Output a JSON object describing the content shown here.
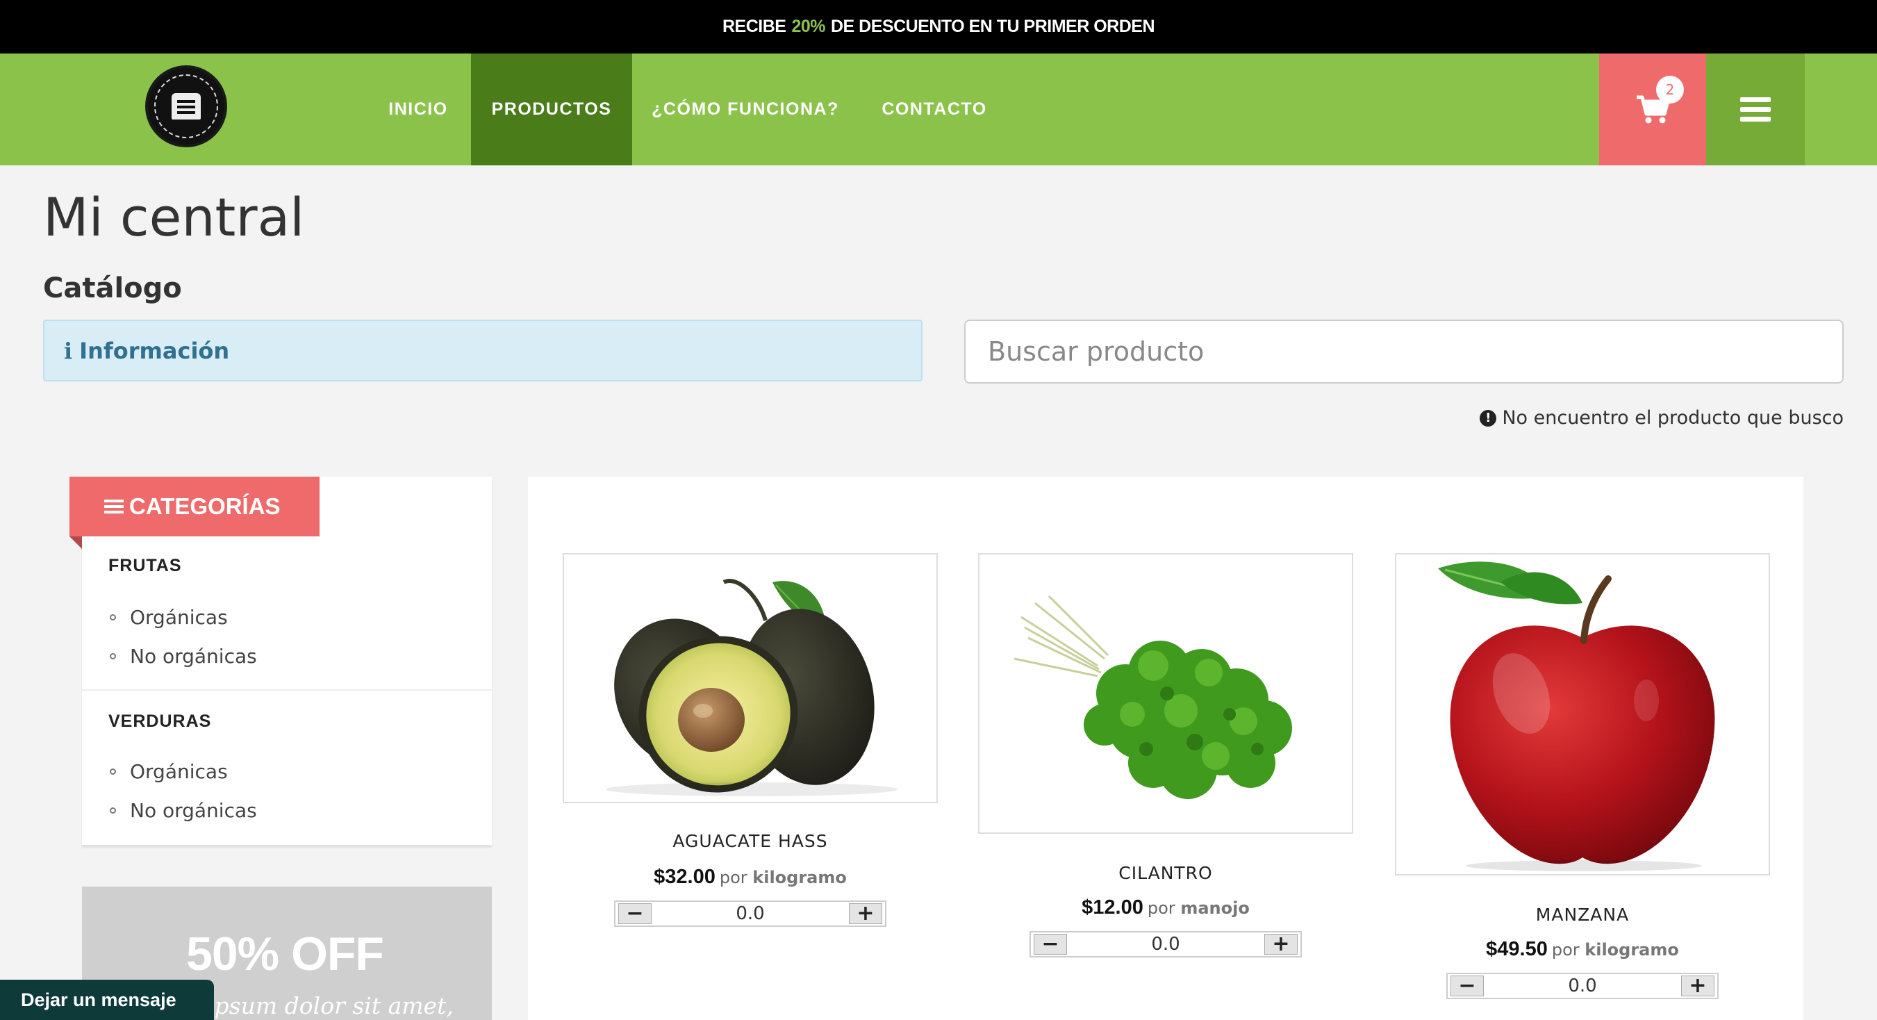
{
  "promo_bar": {
    "prefix": "RECIBE",
    "highlight": "20%",
    "suffix": "DE DESCUENTO EN TU PRIMER ORDEN"
  },
  "nav": {
    "items": [
      {
        "label": "INICIO"
      },
      {
        "label": "PRODUCTOS",
        "active": true
      },
      {
        "label": "¿CÓMO FUNCIONA?"
      },
      {
        "label": "CONTACTO"
      }
    ],
    "cart_count": "2",
    "colors": {
      "bar": "#8bc34a",
      "active": "#4a7c1a",
      "cart": "#ef6b6b",
      "menu": "#77ab38"
    }
  },
  "page": {
    "title": "Mi central",
    "subtitle": "Catálogo",
    "info_label": "Información",
    "info_glyph": "i",
    "search_placeholder": "Buscar producto",
    "not_found_link": "No encuentro el producto que busco"
  },
  "sidebar": {
    "header": "CATEGORÍAS",
    "categories": [
      {
        "name": "FRUTAS",
        "items": [
          "Orgánicas",
          "No orgánicas"
        ]
      },
      {
        "name": "VERDURAS",
        "items": [
          "Orgánicas",
          "No orgánicas"
        ]
      }
    ],
    "promo": {
      "headline": "50% OFF",
      "text": "ipsum dolor sit amet,"
    }
  },
  "products": [
    {
      "name": "AGUACATE HASS",
      "price": "$32.00",
      "por": "por",
      "unit": "kilogramo",
      "qty": "0.0",
      "image": "avocado"
    },
    {
      "name": "CILANTRO",
      "price": "$12.00",
      "por": "por",
      "unit": "manojo",
      "qty": "0.0",
      "image": "cilantro"
    },
    {
      "name": "MANZANA",
      "price": "$49.50",
      "por": "por",
      "unit": "kilogramo",
      "qty": "0.0",
      "image": "apple"
    }
  ],
  "stepper": {
    "minus": "−",
    "plus": "+"
  },
  "chat": {
    "label": "Dejar un mensaje"
  }
}
